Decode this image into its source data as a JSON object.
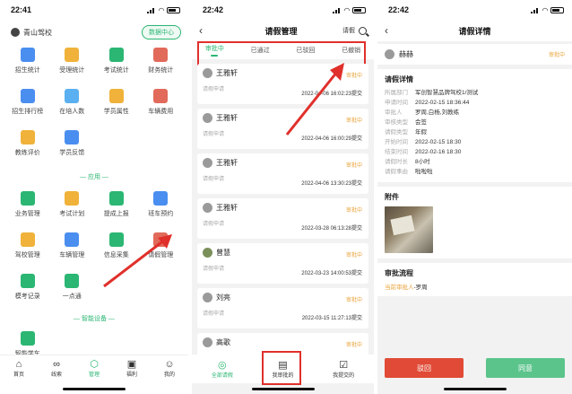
{
  "panel1": {
    "time": "22:41",
    "school": "青山驾校",
    "data_center": "数据中心",
    "row1": [
      {
        "label": "招生统计",
        "icon": "recruit-stats-icon",
        "color": "#4a8ef0"
      },
      {
        "label": "受理统计",
        "icon": "accept-stats-icon",
        "color": "#f0b23a"
      },
      {
        "label": "考试统计",
        "icon": "exam-stats-icon",
        "color": "#2bb673"
      },
      {
        "label": "财务统计",
        "icon": "finance-stats-icon",
        "color": "#e26a5a"
      }
    ],
    "row2": [
      {
        "label": "招生排行榜",
        "icon": "ranking-icon",
        "color": "#4a8ef0"
      },
      {
        "label": "在培人数",
        "icon": "trainees-icon",
        "color": "#5ab0f0"
      },
      {
        "label": "学员属性",
        "icon": "student-attr-icon",
        "color": "#f0b23a"
      },
      {
        "label": "车辆费用",
        "icon": "vehicle-cost-icon",
        "color": "#e26a5a"
      }
    ],
    "row3": [
      {
        "label": "教练评价",
        "icon": "coach-review-icon",
        "color": "#f0b23a"
      },
      {
        "label": "学员反馈",
        "icon": "feedback-icon",
        "color": "#4a8ef0"
      }
    ],
    "section_app": "— 应用 —",
    "row4": [
      {
        "label": "业务管理",
        "icon": "business-icon",
        "color": "#2bb673"
      },
      {
        "label": "考试计划",
        "icon": "exam-plan-icon",
        "color": "#f0b23a"
      },
      {
        "label": "提成上报",
        "icon": "commission-icon",
        "color": "#2bb673"
      },
      {
        "label": "班车预约",
        "icon": "shuttle-icon",
        "color": "#4a8ef0"
      }
    ],
    "row5": [
      {
        "label": "驾校管理",
        "icon": "school-manage-icon",
        "color": "#f0b23a"
      },
      {
        "label": "车辆管理",
        "icon": "vehicle-manage-icon",
        "color": "#4a8ef0"
      },
      {
        "label": "信息采集",
        "icon": "info-collect-icon",
        "color": "#2bb673"
      },
      {
        "label": "请假管理",
        "icon": "leave-manage-icon",
        "color": "#e26a5a"
      }
    ],
    "row6": [
      {
        "label": "模考记录",
        "icon": "mock-exam-icon",
        "color": "#2bb673"
      },
      {
        "label": "一点通",
        "icon": "yidiantong-icon",
        "color": "#2bb673"
      }
    ],
    "section_device": "— 智能设备 —",
    "row7": [
      {
        "label": "智能学车",
        "icon": "smart-car-icon",
        "color": "#2bb673"
      }
    ],
    "tabs": [
      {
        "label": "首页",
        "glyph": "⌂"
      },
      {
        "label": "线索",
        "glyph": "∞"
      },
      {
        "label": "管理",
        "glyph": "⬡"
      },
      {
        "label": "福利",
        "glyph": "▣"
      },
      {
        "label": "我的",
        "glyph": "☺"
      }
    ]
  },
  "panel2": {
    "time": "22:42",
    "title": "请假管理",
    "action": "请假",
    "filters": [
      "审批中",
      "已通过",
      "已驳回",
      "已撤销"
    ],
    "cards": [
      {
        "name": "王雅轩",
        "status": "审批中",
        "type": "请假申请",
        "time": "2022-04-06 16:02:23提交"
      },
      {
        "name": "王雅轩",
        "status": "审批中",
        "type": "请假申请",
        "time": "2022-04-06 16:00:29提交"
      },
      {
        "name": "王雅轩",
        "status": "审批中",
        "type": "请假申请",
        "time": "2022-04-06 13:30:23提交"
      },
      {
        "name": "王雅轩",
        "status": "审批中",
        "type": "请假申请",
        "time": "2022-03-28 06:13:28提交"
      },
      {
        "name": "曾慧",
        "status": "审批中",
        "type": "请假申请",
        "time": "2022-03-23 14:00:53提交"
      },
      {
        "name": "刘亮",
        "status": "审批中",
        "type": "请假申请",
        "time": "2022-03-15 11:27:13提交"
      },
      {
        "name": "高歌",
        "status": "审批中",
        "type": "请假申请",
        "time": ""
      }
    ],
    "tabs": [
      {
        "label": "全部请假",
        "glyph": "◎"
      },
      {
        "label": "我审批的",
        "glyph": "▤"
      },
      {
        "label": "我提交的",
        "glyph": "☑"
      }
    ]
  },
  "panel3": {
    "time": "22:42",
    "title": "请假详情",
    "user": "赫赫",
    "status": "审批中",
    "detail_title": "请假详情",
    "details": [
      {
        "k": "所属部门",
        "v": "军创智慧品牌驾校1/测试"
      },
      {
        "k": "申请时间",
        "v": "2022-02-15 18:36:44"
      },
      {
        "k": "审批人",
        "v": "罗周,白杨,刘教练"
      },
      {
        "k": "审核类型",
        "v": "会签"
      },
      {
        "k": "请假类型",
        "v": "年假"
      },
      {
        "k": "开始时间",
        "v": "2022-02-15 18:30"
      },
      {
        "k": "结束时间",
        "v": "2022-02-16 18:30"
      },
      {
        "k": "请假时长",
        "v": "8小时"
      },
      {
        "k": "请假事由",
        "v": "啦啦啦"
      }
    ],
    "attach_title": "附件",
    "flow_title": "审批流程",
    "flow_current": "当前审批人",
    "flow_person": "-罗周",
    "reject": "驳回",
    "agree": "同意"
  }
}
